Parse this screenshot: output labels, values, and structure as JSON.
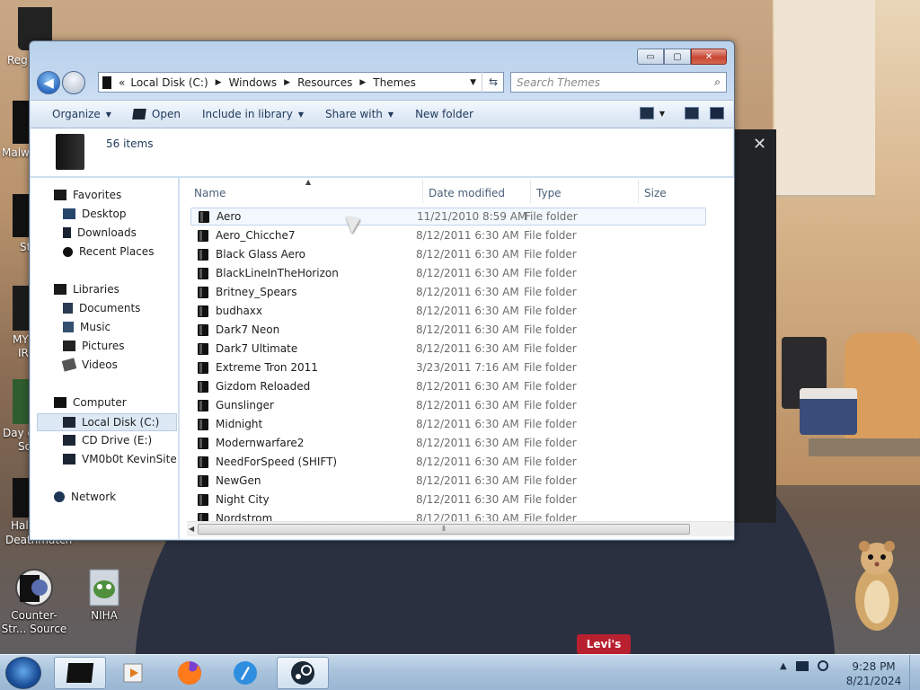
{
  "desktop": {
    "icons": [
      {
        "label": "Counter-Str... Source"
      },
      {
        "label": "NIHA"
      }
    ],
    "partial_labels": [
      "Reg",
      "Malw",
      "St",
      "MY",
      "IR",
      "Day o",
      "Sc",
      "Half",
      "Deathmatch"
    ]
  },
  "window": {
    "address": {
      "crumbs": [
        "Local Disk (C:)",
        "Windows",
        "Resources",
        "Themes"
      ],
      "overflow_glyph": "«"
    },
    "search_placeholder": "Search Themes",
    "toolbar": {
      "organize": "Organize",
      "open": "Open",
      "include_in_library": "Include in library",
      "share_with": "Share with",
      "new_folder": "New folder"
    },
    "details": {
      "item_count": "56 items"
    },
    "nav": {
      "favorites": "Favorites",
      "desktop": "Desktop",
      "downloads": "Downloads",
      "recent_places": "Recent Places",
      "libraries": "Libraries",
      "documents": "Documents",
      "music": "Music",
      "pictures": "Pictures",
      "videos": "Videos",
      "computer": "Computer",
      "local_disk": "Local Disk (C:)",
      "cd_drive": "CD Drive (E:)",
      "vm_share": "VM0b0t KevinSite",
      "network": "Network"
    },
    "columns": {
      "name": "Name",
      "date": "Date modified",
      "type": "Type",
      "size": "Size"
    },
    "files": [
      {
        "name": "Aero",
        "date": "11/21/2010 8:59 AM",
        "type": "File folder"
      },
      {
        "name": "Aero_Chicche7",
        "date": "8/12/2011 6:30 AM",
        "type": "File folder"
      },
      {
        "name": "Black Glass Aero",
        "date": "8/12/2011 6:30 AM",
        "type": "File folder"
      },
      {
        "name": "BlackLineInTheHorizon",
        "date": "8/12/2011 6:30 AM",
        "type": "File folder"
      },
      {
        "name": "Britney_Spears",
        "date": "8/12/2011 6:30 AM",
        "type": "File folder"
      },
      {
        "name": "budhaxx",
        "date": "8/12/2011 6:30 AM",
        "type": "File folder"
      },
      {
        "name": "Dark7 Neon",
        "date": "8/12/2011 6:30 AM",
        "type": "File folder"
      },
      {
        "name": "Dark7 Ultimate",
        "date": "8/12/2011 6:30 AM",
        "type": "File folder"
      },
      {
        "name": "Extreme Tron 2011",
        "date": "3/23/2011 7:16 AM",
        "type": "File folder"
      },
      {
        "name": "Gizdom Reloaded",
        "date": "8/12/2011 6:30 AM",
        "type": "File folder"
      },
      {
        "name": "Gunslinger",
        "date": "8/12/2011 6:30 AM",
        "type": "File folder"
      },
      {
        "name": "Midnight",
        "date": "8/12/2011 6:30 AM",
        "type": "File folder"
      },
      {
        "name": "Modernwarfare2",
        "date": "8/12/2011 6:30 AM",
        "type": "File folder"
      },
      {
        "name": "NeedForSpeed (SHIFT)",
        "date": "8/12/2011 6:30 AM",
        "type": "File folder"
      },
      {
        "name": "NewGen",
        "date": "8/12/2011 6:30 AM",
        "type": "File folder"
      },
      {
        "name": "Night City",
        "date": "8/12/2011 6:30 AM",
        "type": "File folder"
      },
      {
        "name": "Nordstrom",
        "date": "8/12/2011 6:30 AM",
        "type": "File folder"
      }
    ]
  },
  "taskbar": {
    "time": "9:28 PM",
    "date": "8/21/2024"
  },
  "overlay": {
    "close_glyph": "✕"
  },
  "shirt_logo": "Levi's"
}
